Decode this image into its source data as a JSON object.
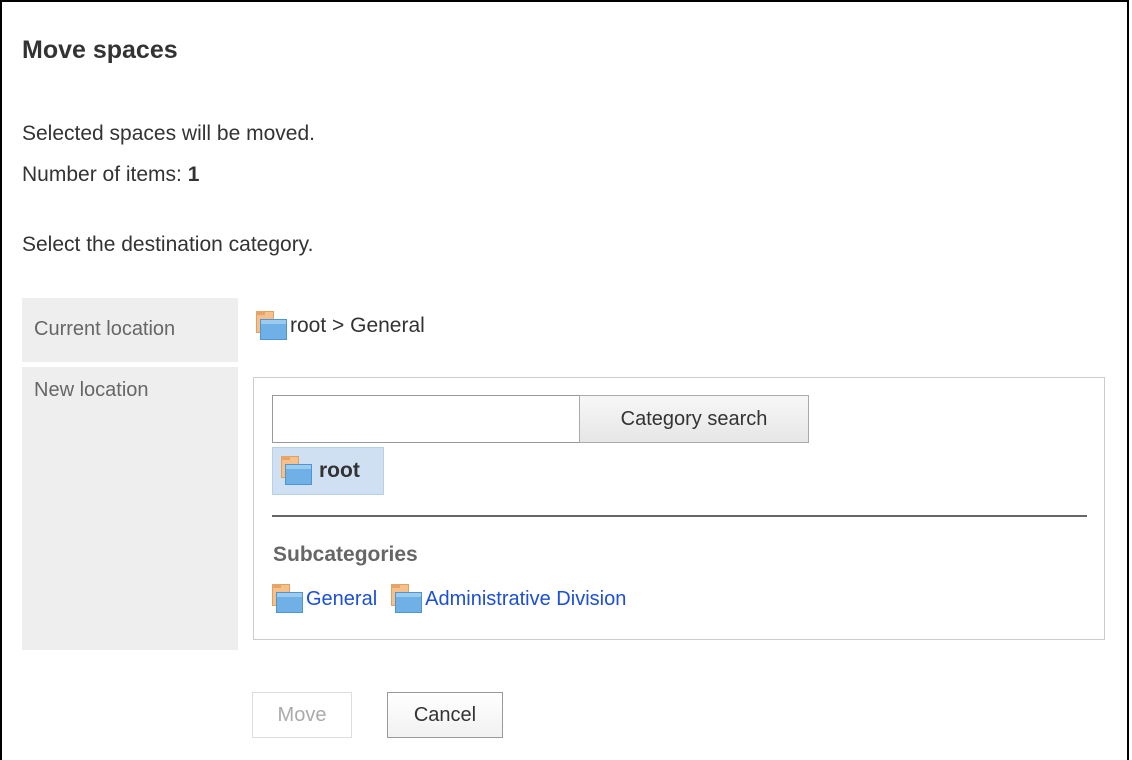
{
  "dialog": {
    "title": "Move spaces",
    "description": "Selected spaces will be moved.",
    "item_count_label": "Number of items: ",
    "item_count": "1",
    "instruction": "Select the destination category."
  },
  "current_location": {
    "label": "Current location",
    "value": "root > General",
    "icon": "folder-icon"
  },
  "new_location": {
    "label": "New location",
    "search": {
      "value": "",
      "placeholder": "",
      "button_label": "Category search"
    },
    "selected_node": {
      "label": "root",
      "icon": "folder-icon"
    },
    "subcategories_heading": "Subcategories",
    "subcategories": [
      {
        "label": "General",
        "icon": "folder-icon"
      },
      {
        "label": "Administrative Division",
        "icon": "folder-icon"
      }
    ]
  },
  "actions": {
    "move_label": "Move",
    "move_enabled": false,
    "cancel_label": "Cancel"
  },
  "colors": {
    "link": "#1b4fd8",
    "label_background": "#eeeeee",
    "selected_node_background": "#cfe0f2",
    "folder_back": "#f5c089",
    "folder_front": "#6fb1e6",
    "disabled_text": "#aaaaaa"
  }
}
